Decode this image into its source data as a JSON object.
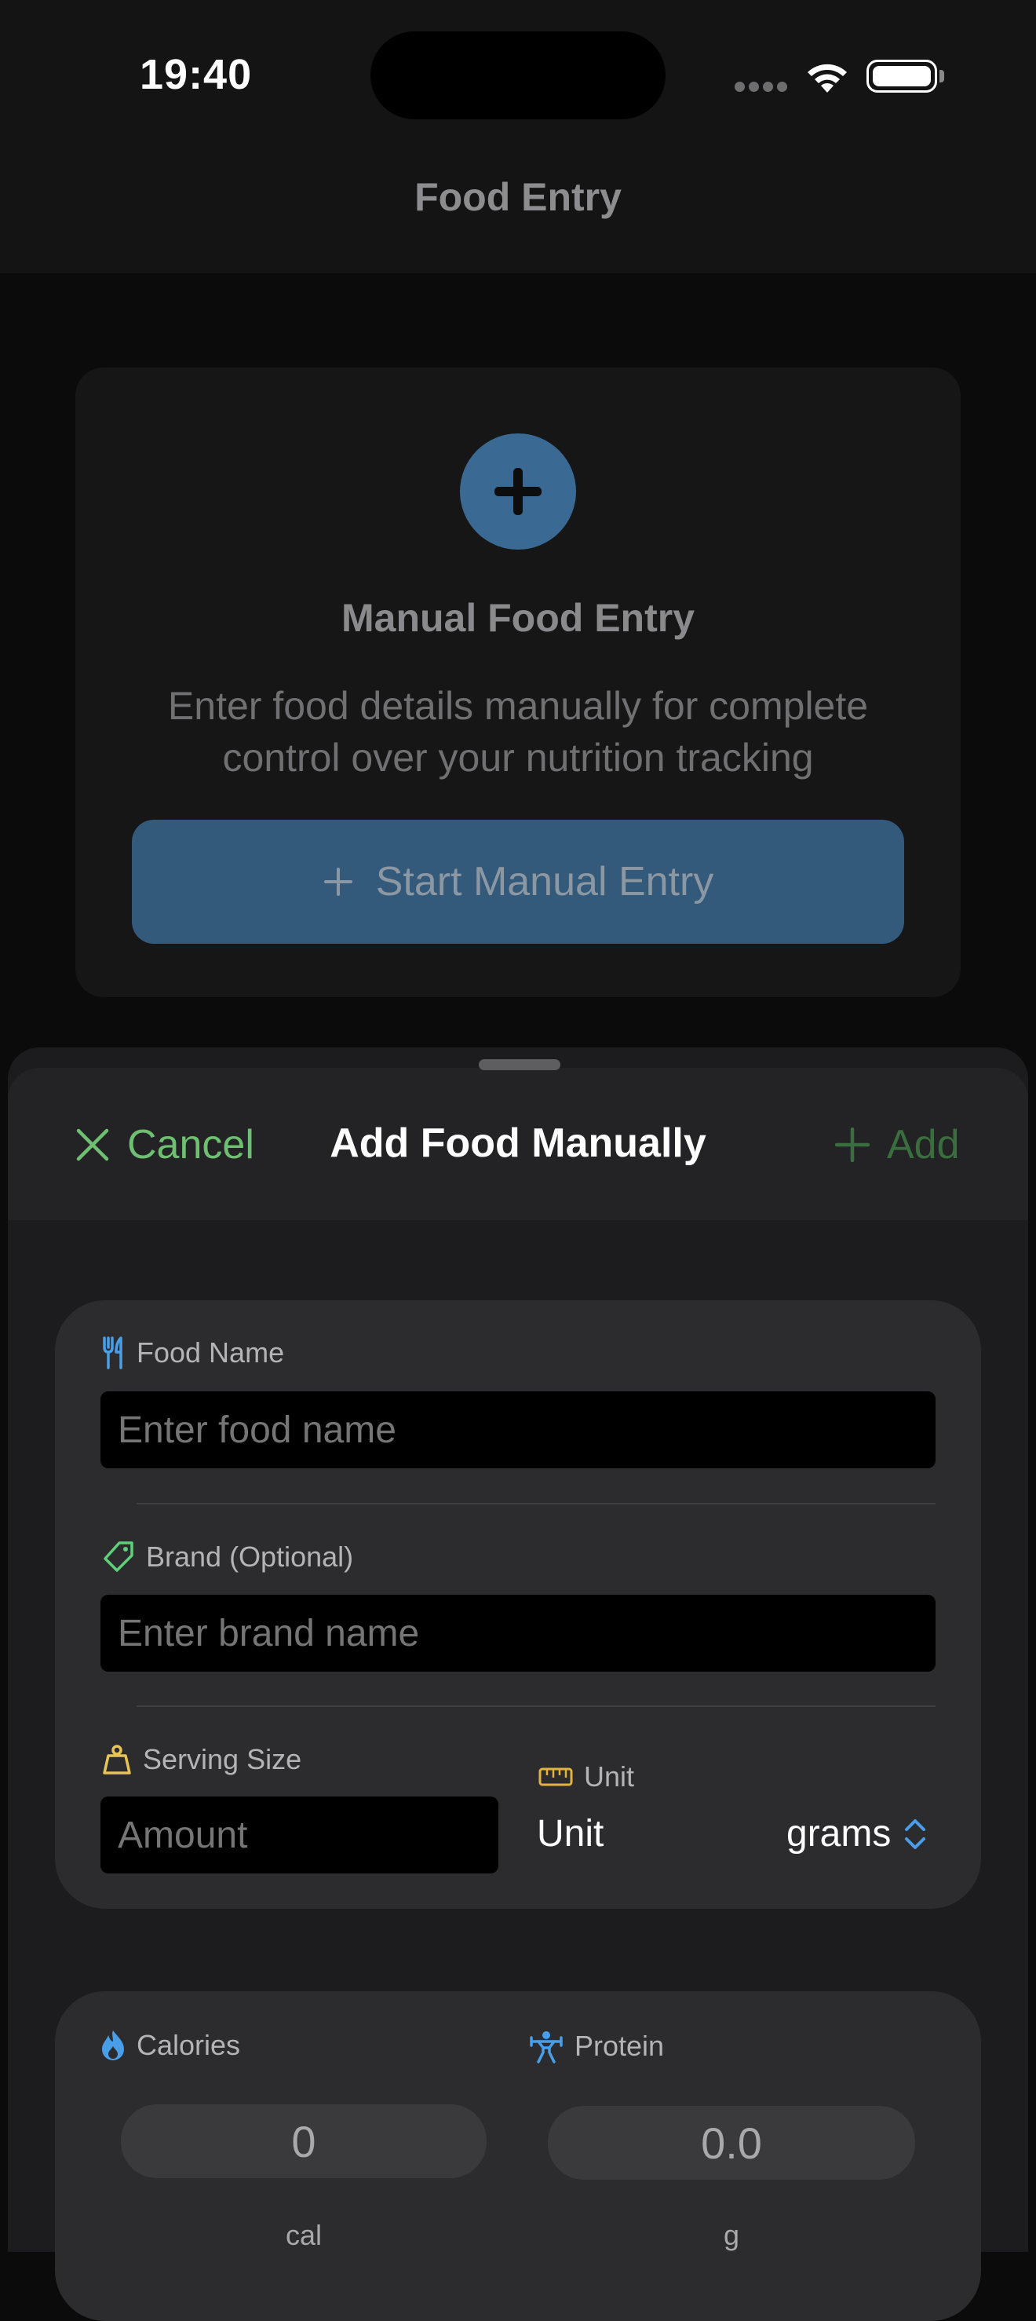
{
  "status_bar": {
    "time": "19:40"
  },
  "background_screen": {
    "nav_title": "Food Entry",
    "card": {
      "title": "Manual Food Entry",
      "description": "Enter food details manually for complete control over your nutrition tracking",
      "button_label": "Start Manual Entry"
    }
  },
  "sheet": {
    "cancel_label": "Cancel",
    "title": "Add Food Manually",
    "add_label": "Add",
    "food_name": {
      "label": "Food Name",
      "placeholder": "Enter food name",
      "value": ""
    },
    "brand": {
      "label": "Brand (Optional)",
      "placeholder": "Enter brand name",
      "value": ""
    },
    "serving_size": {
      "label": "Serving Size",
      "placeholder": "Amount",
      "value": ""
    },
    "unit": {
      "label": "Unit",
      "picker_label": "Unit",
      "selected": "grams"
    },
    "calories": {
      "label": "Calories",
      "value": "0",
      "unit": "cal"
    },
    "protein": {
      "label": "Protein",
      "value": "0.0",
      "unit": "g"
    }
  },
  "colors": {
    "accent_blue": "#4a9ee8",
    "accent_green": "#6fbf73",
    "tag_green": "#5fd07a",
    "ruler_yellow": "#e2b340",
    "weight_yellow": "#e7c45a"
  },
  "icons": {
    "food_name": "fork-knife-icon",
    "brand": "tag-icon",
    "serving_size": "scale-weight-icon",
    "unit": "ruler-icon",
    "calories": "flame-icon",
    "protein": "weightlifter-icon",
    "unit_picker": "chevron-up-down-icon"
  }
}
